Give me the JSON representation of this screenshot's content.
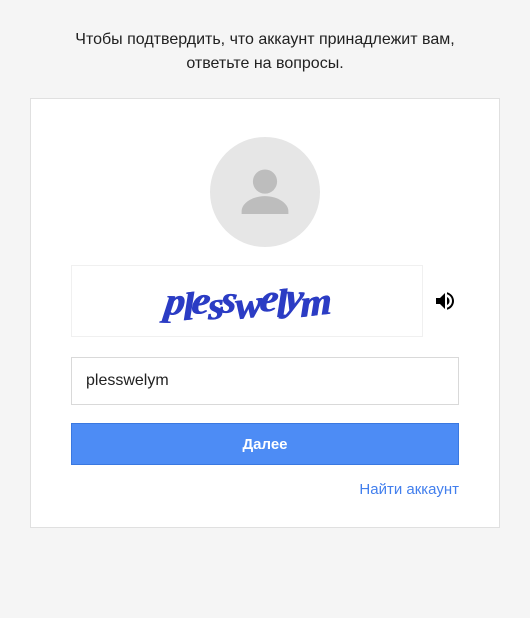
{
  "instructions": "Чтобы подтвердить, что аккаунт принадлежит вам, ответьте на вопросы.",
  "captcha": {
    "display_text": "plesswelym",
    "input_value": "plesswelym",
    "input_placeholder": ""
  },
  "buttons": {
    "next_label": "Далее",
    "find_account_label": "Найти аккаунт"
  },
  "icons": {
    "avatar": "avatar-placeholder-icon",
    "audio": "speaker-icon"
  },
  "colors": {
    "primary": "#4d8cf5",
    "link": "#427fed",
    "captcha_text": "#2b3cc4",
    "card_bg": "#ffffff",
    "page_bg": "#f5f5f5"
  }
}
